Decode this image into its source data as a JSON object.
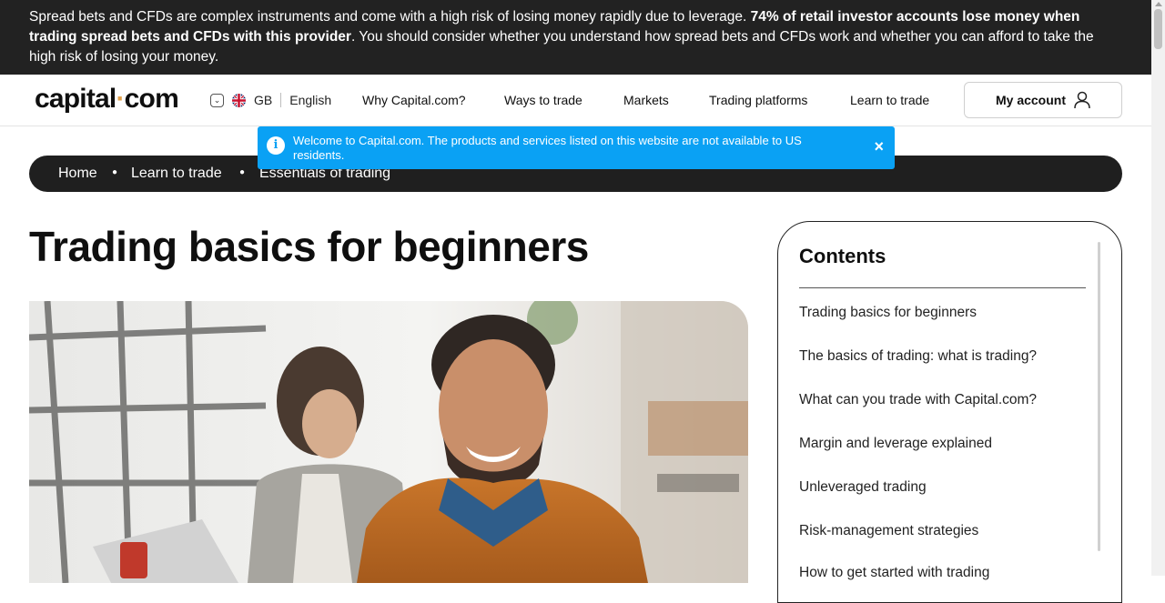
{
  "risk_warning": {
    "part1": "Spread bets and CFDs are complex instruments and come with a high risk of losing money rapidly due to leverage. ",
    "bold": "74% of retail investor accounts lose money when trading spread bets and CFDs with this provider",
    "part2": ". You should consider whether you understand how spread bets and CFDs work and whether you can afford to take the high risk of losing your money."
  },
  "header": {
    "logo_left": "capital",
    "logo_dot": "·",
    "logo_right": "com",
    "region_code": "GB",
    "language": "English",
    "nav": [
      "Why Capital.com?",
      "Ways to trade",
      "Markets",
      "Trading platforms",
      "Learn to trade"
    ],
    "account_label": "My account"
  },
  "notice": {
    "text": "Welcome to Capital.com. The products and services listed on this website are not available to US residents.",
    "close": "×",
    "icon": "info-icon"
  },
  "breadcrumb": [
    "Home",
    "Learn to trade",
    "Essentials of trading"
  ],
  "page_title": "Trading basics for beginners",
  "contents": {
    "title": "Contents",
    "items": [
      "Trading basics for beginners",
      "The basics of trading: what is trading?",
      "What can you trade with Capital.com?",
      "Margin and leverage explained",
      "Unleveraged trading",
      "Risk-management strategies",
      "How to get started with trading"
    ]
  },
  "colors": {
    "risk_bar": "#222222",
    "notice": "#0aa1f4",
    "logo_dot": "#e2a14b",
    "breadcrumb": "#1f1f1f"
  }
}
